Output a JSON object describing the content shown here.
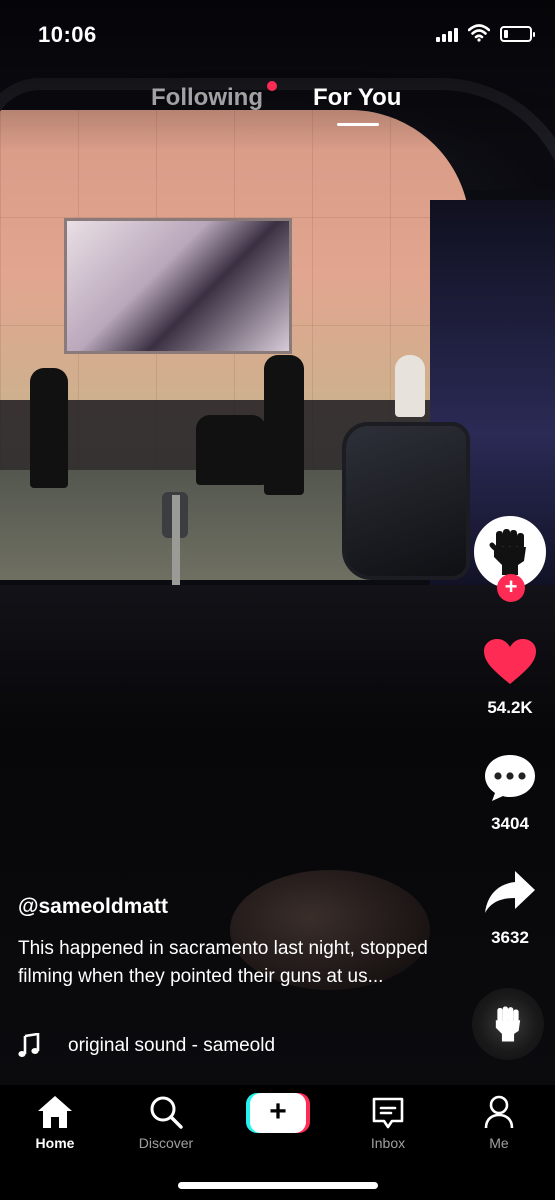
{
  "status_bar": {
    "time": "10:06",
    "icons": [
      "cellular-signal-icon",
      "wifi-icon",
      "battery-icon"
    ],
    "battery_level": 0.15
  },
  "feed_tabs": {
    "following": "Following",
    "for_you": "For You",
    "active": "For You",
    "notification_dot_color": "#fe2c55"
  },
  "creator": {
    "avatar_icon": "raised-fist-icon",
    "follow_icon": "plus-icon",
    "follow_label": "+"
  },
  "actions": {
    "like": {
      "icon": "heart-icon",
      "count": "54.2K",
      "color": "#fe2c55"
    },
    "comment": {
      "icon": "comment-bubble-icon",
      "count": "3404"
    },
    "share": {
      "icon": "share-arrow-icon",
      "count": "3632"
    }
  },
  "post": {
    "username": "@sameoldmatt",
    "caption": "This happened in sacramento last night, stopped filming when they pointed their guns at us...",
    "sound_icon": "music-note-icon",
    "sound": "original sound - sameold"
  },
  "sound_disc": {
    "icon": "raised-fist-icon"
  },
  "bottom_nav": {
    "items": [
      {
        "label": "Home",
        "icon": "home-icon",
        "active": true
      },
      {
        "label": "Discover",
        "icon": "search-icon",
        "active": false
      },
      {
        "label": "Inbox",
        "icon": "inbox-icon",
        "active": false
      },
      {
        "label": "Me",
        "icon": "profile-icon",
        "active": false
      }
    ],
    "create_label": "+",
    "create_colors": {
      "cyan": "#25f4ee",
      "red": "#fe2c55"
    }
  },
  "colors": {
    "brand_red": "#fe2c55",
    "brand_cyan": "#25f4ee"
  }
}
